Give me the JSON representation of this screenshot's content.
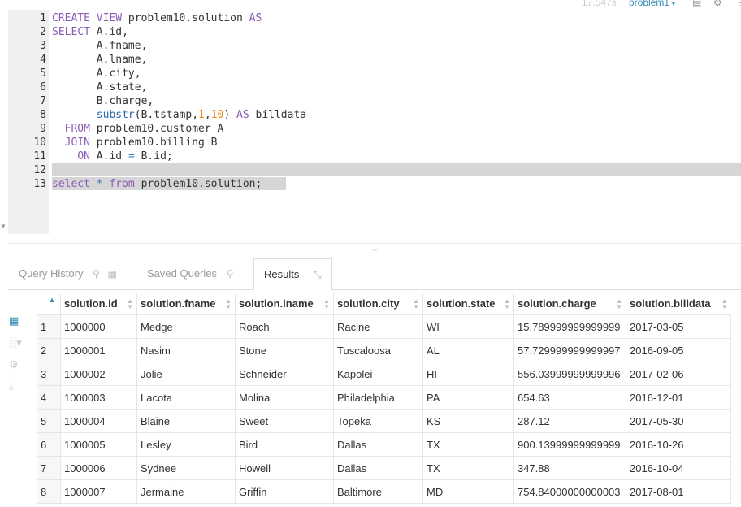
{
  "topbar": {
    "exec_time": "17.547s",
    "db_name": "problem1",
    "caret": "▾",
    "icons": [
      "document-icon",
      "gear-icon",
      "more-icon"
    ]
  },
  "editor": {
    "line_numbers": [
      "1",
      "2",
      "3",
      "4",
      "5",
      "6",
      "7",
      "8",
      "9",
      "10",
      "11",
      "12",
      "13"
    ],
    "lines": [
      [
        {
          "t": "CREATE",
          "c": "kw"
        },
        {
          "t": " "
        },
        {
          "t": "VIEW",
          "c": "kw"
        },
        {
          "t": " problem10.solution "
        },
        {
          "t": "AS",
          "c": "kw"
        }
      ],
      [
        {
          "t": "SELECT",
          "c": "kw"
        },
        {
          "t": " A.id,"
        }
      ],
      [
        {
          "t": "       A.fname,"
        }
      ],
      [
        {
          "t": "       A.lname,"
        }
      ],
      [
        {
          "t": "       A.city,"
        }
      ],
      [
        {
          "t": "       A.state,"
        }
      ],
      [
        {
          "t": "       B.charge,"
        }
      ],
      [
        {
          "t": "       "
        },
        {
          "t": "substr",
          "c": "fn"
        },
        {
          "t": "(B.tstamp,"
        },
        {
          "t": "1",
          "c": "num"
        },
        {
          "t": ","
        },
        {
          "t": "10",
          "c": "num"
        },
        {
          "t": ") "
        },
        {
          "t": "AS",
          "c": "kw"
        },
        {
          "t": " billdata"
        }
      ],
      [
        {
          "t": "  "
        },
        {
          "t": "FROM",
          "c": "kw"
        },
        {
          "t": " problem10.customer A"
        }
      ],
      [
        {
          "t": "  "
        },
        {
          "t": "JOIN",
          "c": "kw"
        },
        {
          "t": " problem10.billing B"
        }
      ],
      [
        {
          "t": "    "
        },
        {
          "t": "ON",
          "c": "kw"
        },
        {
          "t": " A.id "
        },
        {
          "t": "=",
          "c": "op"
        },
        {
          "t": " B.id;"
        }
      ],
      [
        {
          "t": ""
        }
      ],
      [
        {
          "t": "select",
          "c": "kw"
        },
        {
          "t": " "
        },
        {
          "t": "*",
          "c": "op"
        },
        {
          "t": " "
        },
        {
          "t": "from",
          "c": "kw"
        },
        {
          "t": " problem10.solution;"
        }
      ]
    ]
  },
  "tabs": {
    "query_history": "Query History",
    "saved_queries": "Saved Queries",
    "results": "Results"
  },
  "results": {
    "columns": [
      "solution.id",
      "solution.fname",
      "solution.lname",
      "solution.city",
      "solution.state",
      "solution.charge",
      "solution.billdata"
    ],
    "rows": [
      [
        "1",
        "1000000",
        "Medge",
        "Roach",
        "Racine",
        "WI",
        "15.789999999999999",
        "2017-03-05"
      ],
      [
        "2",
        "1000001",
        "Nasim",
        "Stone",
        "Tuscaloosa",
        "AL",
        "57.729999999999997",
        "2016-09-05"
      ],
      [
        "3",
        "1000002",
        "Jolie",
        "Schneider",
        "Kapolei",
        "HI",
        "556.03999999999996",
        "2017-02-06"
      ],
      [
        "4",
        "1000003",
        "Lacota",
        "Molina",
        "Philadelphia",
        "PA",
        "654.63",
        "2016-12-01"
      ],
      [
        "5",
        "1000004",
        "Blaine",
        "Sweet",
        "Topeka",
        "KS",
        "287.12",
        "2017-05-30"
      ],
      [
        "6",
        "1000005",
        "Lesley",
        "Bird",
        "Dallas",
        "TX",
        "900.13999999999999",
        "2016-10-26"
      ],
      [
        "7",
        "1000006",
        "Sydnee",
        "Howell",
        "Dallas",
        "TX",
        "347.88",
        "2016-10-04"
      ],
      [
        "8",
        "1000007",
        "Jermaine",
        "Griffin",
        "Baltimore",
        "MD",
        "754.84000000000003",
        "2017-08-01"
      ]
    ]
  },
  "colors": {
    "accent": "#338bb8",
    "keyword": "#8a5cb6",
    "number": "#e8881b",
    "selection": "#d6d6d6"
  }
}
